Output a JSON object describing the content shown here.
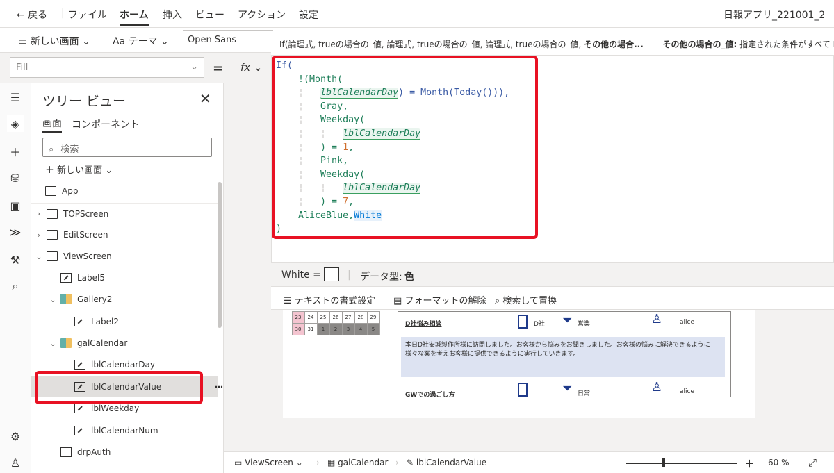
{
  "menu": {
    "back": "戻る",
    "file": "ファイル",
    "home": "ホーム",
    "insert": "挿入",
    "view": "ビュー",
    "action": "アクション",
    "settings": "設定",
    "app_name": "日報アプリ_221001_2"
  },
  "toolbar": {
    "new_screen": "新しい画面",
    "theme": "テーマ",
    "font": "Open Sans"
  },
  "formula_bar": {
    "property": "Fill",
    "equals": "=",
    "fx": "fx"
  },
  "hint": {
    "signature": "If(論理式, trueの場合の_値, 論理式, trueの場合の_値, 論理式, trueの場合の_値,",
    "signature_bold": "その他の場合...",
    "param_name": "その他の場合の_値:",
    "param_desc": "指定された条件がすべて Fa"
  },
  "code": {
    "l1": "If(",
    "l2_fn": "!(Month(",
    "l3_id": "lblCalendarDay",
    "l3_rest": ") = Month(Today())),",
    "l4": "Gray,",
    "l5": "Weekday(",
    "l6_id": "lblCalendarDay",
    "l7_a": ") = ",
    "l7_num": "1",
    "l7_b": ",",
    "l8": "Pink,",
    "l9": "Weekday(",
    "l10_id": "lblCalendarDay",
    "l11_a": ") = ",
    "l11_num": "7",
    "l11_b": ",",
    "l12_a": "AliceBlue,",
    "l12_b": "White",
    "l13": ")"
  },
  "result": {
    "value_label": "White  =",
    "type_label": "データ型:",
    "type_value": "色"
  },
  "format": {
    "text_format": "テキストの書式設定",
    "remove_format": "フォーマットの解除",
    "find_replace": "検索して置換"
  },
  "tree": {
    "title": "ツリー ビュー",
    "tab_screens": "画面",
    "tab_components": "コンポーネント",
    "search_placeholder": "検索",
    "new_screen": "新しい画面",
    "items": [
      {
        "label": "App"
      },
      {
        "label": "TOPScreen"
      },
      {
        "label": "EditScreen"
      },
      {
        "label": "ViewScreen"
      },
      {
        "label": "Label5"
      },
      {
        "label": "Gallery2"
      },
      {
        "label": "Label2"
      },
      {
        "label": "galCalendar"
      },
      {
        "label": "lblCalendarDay"
      },
      {
        "label": "lblCalendarValue"
      },
      {
        "label": "lblWeekday"
      },
      {
        "label": "lblCalendarNum"
      },
      {
        "label": "drpAuth"
      }
    ]
  },
  "calendar": {
    "row1": [
      "23",
      "24",
      "25",
      "26",
      "27",
      "28",
      "29"
    ],
    "row2": [
      "30",
      "31",
      "1",
      "2",
      "3",
      "4",
      "5"
    ]
  },
  "gallery": {
    "card1_title": "D社悩み相談",
    "card1_company": "D社",
    "card1_type": "営業",
    "card1_user": "alice",
    "card1_body": "本日D社安城製作所様に訪問しました。お客様から悩みをお聞きしました。お客様の悩みに解決できるように様々な案を考えお客様に提供できるように実行していきます。",
    "card2_title": "GWでの過ごし方",
    "card2_type": "日常",
    "card2_user": "alice"
  },
  "status": {
    "screen": "ViewScreen",
    "gallery": "galCalendar",
    "control": "lblCalendarValue",
    "zoom": "60 %"
  }
}
